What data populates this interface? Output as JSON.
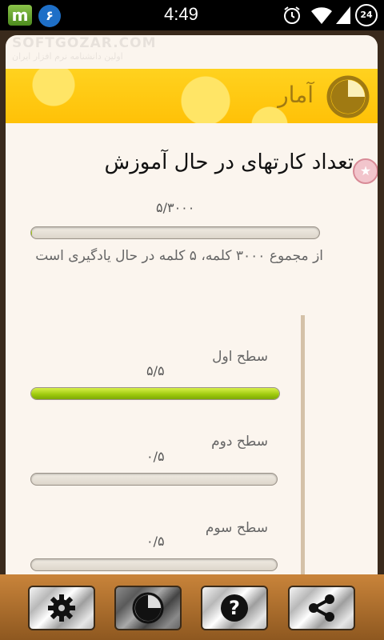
{
  "status_bar": {
    "app_m_label": "m",
    "app_6_label": "۶",
    "time": "4:49",
    "battery_level": "24"
  },
  "watermark": {
    "brand": "SOFTGOZAR.COM",
    "subtitle": "اولین دانشنامه نرم افزار ایران"
  },
  "header": {
    "title": "آمار",
    "icon": "pie-chart-icon"
  },
  "section": {
    "title": "تعداد کارتهای در حال آموزش",
    "total_count": "۵/۳۰۰۰",
    "total_progress": 0.0017,
    "description": "از مجموع ۳۰۰۰ کلمه، ۵ کلمه در حال یادگیری است"
  },
  "levels": [
    {
      "label": "سطح اول",
      "count": "۵/۵",
      "progress": 1.0
    },
    {
      "label": "سطح دوم",
      "count": "۰/۵",
      "progress": 0.0
    },
    {
      "label": "سطح سوم",
      "count": "۰/۵",
      "progress": 0.0
    }
  ],
  "toolbar": {
    "items": [
      {
        "icon": "gear-icon",
        "active": false
      },
      {
        "icon": "pie-chart-icon",
        "active": true
      },
      {
        "icon": "help-icon",
        "active": false
      },
      {
        "icon": "share-icon",
        "active": false
      }
    ]
  },
  "colors": {
    "header_yellow": "#ffc107",
    "header_text": "#a07a12",
    "progress_green": "#9cc80c",
    "toolbar_brown": "#a86a2a"
  }
}
